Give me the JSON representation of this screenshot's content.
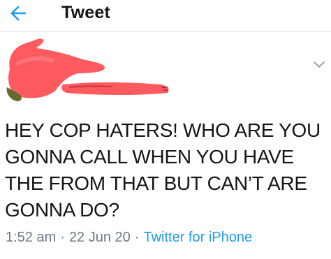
{
  "header": {
    "title": "Tweet",
    "back_icon": "arrow-left-icon",
    "accent_color": "#1d9bf0"
  },
  "author": {
    "redaction_color": "#ff5a5f",
    "menu_icon": "chevron-down-icon"
  },
  "tweet": {
    "lines": [
      "HEY COP HATERS! WHO ARE YOU",
      "GONNA CALL WHEN YOU HAVE",
      "THE FROM THAT BUT CAN’T ARE",
      "GONNA DO?"
    ]
  },
  "meta": {
    "time": "1:52 am",
    "separator": "·",
    "date": "22 Jun 20",
    "source": "Twitter for iPhone",
    "muted_color": "#6b7a86"
  }
}
